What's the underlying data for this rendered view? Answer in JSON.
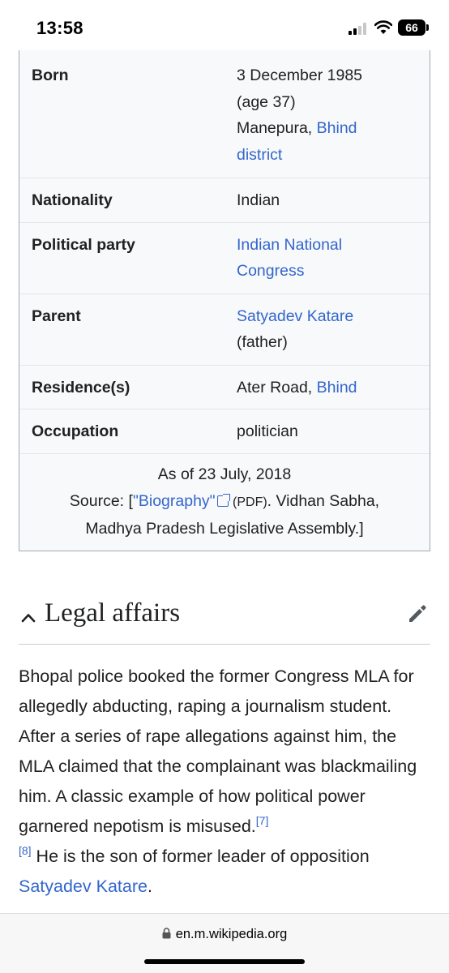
{
  "status_bar": {
    "time": "13:58",
    "battery": "66"
  },
  "infobox": {
    "born": {
      "label": "Born",
      "line1": "3 December 1985",
      "line2": "(age 37)",
      "place_text": "Manepura, ",
      "place_link_1": "Bhind",
      "place_link_2": "district"
    },
    "nationality": {
      "label": "Nationality",
      "value": "Indian"
    },
    "party": {
      "label": "Political party",
      "link_1": "Indian National",
      "link_2": "Congress"
    },
    "parent": {
      "label": "Parent",
      "link": "Satyadev Katare",
      "note": "(father)"
    },
    "residence": {
      "label": "Residence(s)",
      "text": "Ater Road, ",
      "link": "Bhind"
    },
    "occupation": {
      "label": "Occupation",
      "value": "politician"
    },
    "footer": {
      "as_of": "As of 23 July, 2018",
      "source_prefix": "Source: [",
      "source_link": "\"Biography\"",
      "pdf": "(PDF)",
      "source_rest": ". Vidhan Sabha,",
      "line3": "Madhya Pradesh Legislative Assembly.]"
    }
  },
  "section": {
    "title": "Legal affairs",
    "paragraph_1": "Bhopal police booked the former Congress MLA for allegedly abducting, raping a journalism student. After a series of rape allegations against him, the MLA claimed that the complainant was blackmailing him. A classic example of how political power garnered nepotism is misused.",
    "ref_7": "[7]",
    "ref_8": "[8]",
    "paragraph_2": " He is the son of former leader of opposition ",
    "link": "Satyadev Katare",
    "end": "."
  },
  "browser": {
    "url": "en.m.wikipedia.org"
  },
  "colors": {
    "link": "#3366cc",
    "infobox_bg": "#f8f9fa",
    "border": "#a2a9b1"
  },
  "icons": [
    "signal-icon",
    "wifi-icon",
    "battery-icon",
    "chevron-up-icon",
    "pencil-edit-icon",
    "external-link-icon",
    "lock-icon"
  ]
}
